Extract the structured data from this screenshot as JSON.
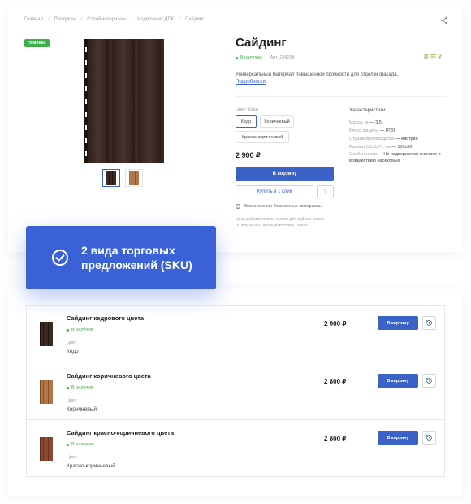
{
  "breadcrumb": [
    "Главная",
    "Продукты",
    "Стройматериалы",
    "Изделия из ДПК",
    "Сайдинг"
  ],
  "badge": "Новинка",
  "product": {
    "title": "Сайдинг",
    "stock": "В наличии",
    "article": "Арт. 234234",
    "brand": "R☰Y",
    "description": "Универсальный материал повышенной прочности для отделки фасада.",
    "more_link": "Подробности",
    "color_label": "Цвет: Кедр",
    "colors": [
      "Кедр",
      "Коричневый",
      "Красно-коричневый"
    ],
    "price": "2 900 ₽",
    "cart_label": "В корзину",
    "oneclick_label": "Купить в 1 клик",
    "question_label": "?",
    "eco_note": "Экологически безопасные материалы",
    "price_note": "Цена действительна только для сайта и может отличаться от цен в розничных точках"
  },
  "characteristics": {
    "title": "Характеристики",
    "rows": [
      {
        "k": "Масса, кг",
        "v": "3,5"
      },
      {
        "k": "Класс защиты",
        "v": "IP20"
      },
      {
        "k": "Страна производства",
        "v": "Австрия"
      },
      {
        "k": "Размер (ШхВхГ), см",
        "v": "150х50"
      },
      {
        "k": "Особенности",
        "v": "Не подвергается гниению и воздействию насекомых"
      }
    ]
  },
  "callout": {
    "text": "2 вида торговых предложений (SKU)"
  },
  "sku_list": [
    {
      "name": "Сайдинг кедрового цвета",
      "stock": "В наличии",
      "color_label": "Цвет",
      "color": "Кедр",
      "price": "2 900 ₽",
      "btn": "В корзину",
      "swatch": "#3d2924"
    },
    {
      "name": "Сайдинг коричневого цвета",
      "stock": "В наличии",
      "color_label": "Цвет",
      "color": "Коричневый",
      "price": "2 800 ₽",
      "btn": "В корзину",
      "swatch": "#b07646"
    },
    {
      "name": "Сайдинг красно-коричневого цвета",
      "stock": "В наличии",
      "color_label": "Цвет",
      "color": "Красно-коричневый",
      "price": "2 800 ₽",
      "btn": "В корзину",
      "swatch": "#8a4a2e"
    }
  ],
  "colors": {
    "accent": "#3a62c7",
    "callout": "#3a62d6",
    "stock": "#3fae4a"
  }
}
